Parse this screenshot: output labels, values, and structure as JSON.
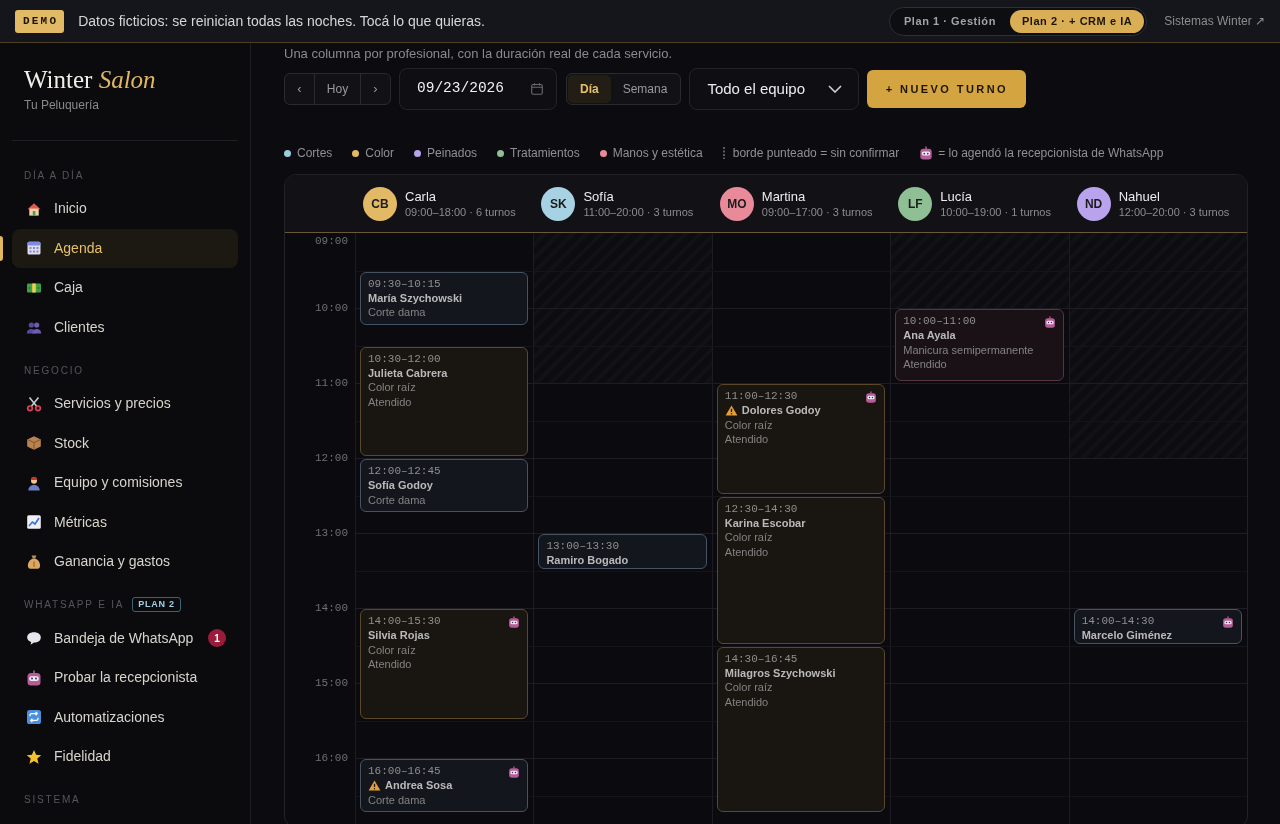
{
  "top_bar": {
    "badge": "DEMO",
    "notice": "Datos ficticios: se reinician todas las noches. Tocá lo que quieras.",
    "plans": [
      {
        "label": "Plan 1 · Gestión",
        "selected": false
      },
      {
        "label": "Plan 2 · + CRM e IA",
        "selected": true
      }
    ],
    "link": "Sistemas Winter ↗"
  },
  "sidebar": {
    "brand": "Winter *Salon*",
    "subtitle": "Tu Peluquería",
    "sections": [
      {
        "title": "DÍA A DÍA",
        "items": [
          {
            "label": "Inicio",
            "selected": false
          },
          {
            "label": "Agenda",
            "selected": true
          },
          {
            "label": "Caja",
            "selected": false
          },
          {
            "label": "Clientes",
            "selected": false
          }
        ]
      },
      {
        "title": "NEGOCIO",
        "items": [
          {
            "label": "Servicios y precios",
            "selected": false
          },
          {
            "label": "Stock",
            "selected": false
          },
          {
            "label": "Equipo y comisiones",
            "selected": false
          },
          {
            "label": "Métricas",
            "selected": false
          },
          {
            "label": "Ganancia y gastos",
            "selected": false
          }
        ]
      },
      {
        "title": "WHATSAPP E IA",
        "badge": "PLAN 2",
        "items": [
          {
            "label": "Bandeja de WhatsApp",
            "selected": false,
            "count": "1"
          },
          {
            "label": "Probar la recepcionista",
            "selected": false
          },
          {
            "label": "Automatizaciones",
            "selected": false
          },
          {
            "label": "Fidelidad",
            "selected": false
          }
        ]
      },
      {
        "title": "SISTEMA"
      }
    ]
  },
  "main": {
    "subtitle": "Una columna por profesional, con la duración real de cada servicio.",
    "toolbar": {
      "prev": "‹",
      "today": "Hoy",
      "next": "›",
      "date": "09/23/2026",
      "views": [
        {
          "label": "Día",
          "selected": true
        },
        {
          "label": "Semana",
          "selected": false
        }
      ],
      "team_select": "Todo el equipo",
      "new_button": "+ NUEVO TURNO"
    },
    "legend": {
      "categories": [
        {
          "label": "Cortes",
          "color": "#9ccbdf"
        },
        {
          "label": "Color",
          "color": "#e2b964"
        },
        {
          "label": "Peinados",
          "color": "#b7a2ea"
        },
        {
          "label": "Tratamientos",
          "color": "#8fbf97"
        },
        {
          "label": "Manos y estética",
          "color": "#e88a9a"
        }
      ],
      "dashed_note": "borde punteado = sin confirmar",
      "bot_note": "= lo agendó la recepcionista de WhatsApp"
    },
    "calendar": {
      "hours": [
        "09:00",
        "10:00",
        "11:00",
        "12:00",
        "13:00",
        "14:00",
        "15:00",
        "16:00"
      ],
      "staff": [
        {
          "initials": "CB",
          "name": "Carla",
          "color": "#e2b964",
          "hours": "09:00–18:00 · 6 turnos",
          "appointments": [
            {
              "time": "09:30–10:15",
              "client": "María Szychowski",
              "service": "Corte dama",
              "kind": "cortes",
              "warning": false,
              "bot_booked": false
            },
            {
              "time": "10:30–12:00",
              "client": "Julieta Cabrera",
              "service": "Color raíz",
              "status": "Atendido",
              "kind": "color",
              "warning": false,
              "bot_booked": false
            },
            {
              "time": "12:00–12:45",
              "client": "Sofía Godoy",
              "service": "Corte dama",
              "kind": "cortes",
              "warning": false,
              "bot_booked": false
            },
            {
              "time": "14:00–15:30",
              "client": "Silvia Rojas",
              "service": "Color raíz",
              "status": "Atendido",
              "kind": "color",
              "warning": false,
              "bot_booked": true
            },
            {
              "time": "16:00–16:45",
              "client": "Andrea Sosa",
              "service": "Corte dama",
              "kind": "cortes",
              "warning": true,
              "bot_booked": true
            }
          ]
        },
        {
          "initials": "SK",
          "name": "Sofía",
          "color": "#a6d2e3",
          "hours": "11:00–20:00 · 3 turnos",
          "appointments": [
            {
              "time": "13:00–13:30",
              "client": "Ramiro Bogado",
              "kind": "cortes",
              "warning": false,
              "bot_booked": false
            }
          ]
        },
        {
          "initials": "MO",
          "name": "Martina",
          "color": "#e88a9a",
          "hours": "09:00–17:00 · 3 turnos",
          "appointments": [
            {
              "time": "11:00–12:30",
              "client": "Dolores Godoy",
              "service": "Color raíz",
              "status": "Atendido",
              "kind": "color",
              "warning": true,
              "bot_booked": true
            },
            {
              "time": "12:30–14:30",
              "client": "Karina Escobar",
              "service": "Color raíz",
              "status": "Atendido",
              "kind": "color",
              "warning": false,
              "bot_booked": false
            },
            {
              "time": "14:30–16:45",
              "client": "Milagros Szychowski",
              "service": "Color raíz",
              "status": "Atendido",
              "kind": "color",
              "warning": false,
              "bot_booked": false
            }
          ]
        },
        {
          "initials": "LF",
          "name": "Lucía",
          "color": "#8fbf95",
          "hours": "10:00–19:00 · 1 turnos",
          "appointments": [
            {
              "time": "10:00–11:00",
              "client": "Ana Ayala",
              "service": "Manicura semipermanente",
              "status": "Atendido",
              "kind": "manos",
              "warning": false,
              "bot_booked": true
            }
          ]
        },
        {
          "initials": "ND",
          "name": "Nahuel",
          "color": "#b9a3ec",
          "hours": "12:00–20:00 · 3 turnos",
          "appointments": [
            {
              "time": "14:00–14:30",
              "client": "Marcelo Giménez",
              "kind": "cortes",
              "warning": false,
              "bot_booked": true
            }
          ]
        }
      ]
    }
  }
}
